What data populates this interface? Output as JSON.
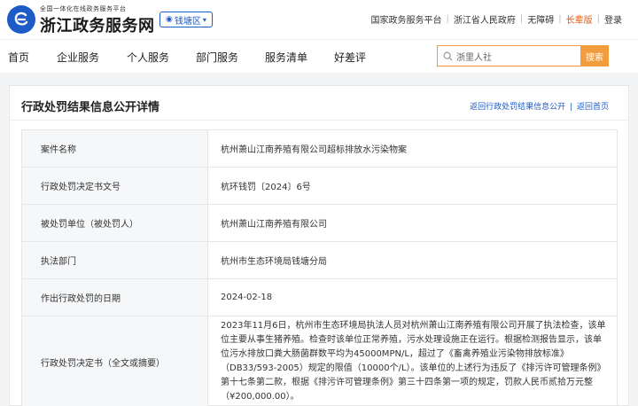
{
  "header": {
    "subtitle": "全国一体化在线政务服务平台",
    "title": "浙江政务服务网",
    "region": "钱塘区",
    "links": [
      "国家政务服务平台",
      "浙江省人民政府",
      "无障碍",
      "长辈版",
      "登录"
    ]
  },
  "nav": {
    "items": [
      "首页",
      "企业服务",
      "个人服务",
      "部门服务",
      "服务清单",
      "好差评"
    ]
  },
  "search": {
    "value": "浙里人社",
    "button": "搜索"
  },
  "page": {
    "title": "行政处罚结果信息公开详情",
    "back_list": "返回行政处罚结果信息公开",
    "link_sep": "|",
    "back_home": "返回首页"
  },
  "details": [
    {
      "label": "案件名称",
      "value": "杭州萧山江南养殖有限公司超标排放水污染物案"
    },
    {
      "label": "行政处罚决定书文号",
      "value": "杭环钱罚〔2024〕6号"
    },
    {
      "label": "被处罚单位（被处罚人）",
      "value": "杭州萧山江南养殖有限公司"
    },
    {
      "label": "执法部门",
      "value": "杭州市生态环境局钱塘分局"
    },
    {
      "label": "作出行政处罚的日期",
      "value": "2024-02-18"
    },
    {
      "label": "行政处罚决定书（全文或摘要）",
      "value": "2023年11月6日，杭州市生态环境局执法人员对杭州萧山江南养殖有限公司开展了执法检查，该单位主要从事生猪养殖。检查时该单位正常养殖，污水处理设施正在运行。根据检测报告显示，该单位污水排放口粪大肠菌群数平均为45000MPN/L，超过了《畜禽养殖业污染物排放标准》（DB33/593-2005）规定的限值（10000个/L）。该单位的上述行为违反了《排污许可管理条例》第十七条第二款，根据《排污许可管理条例》第三十四条第一项的规定，罚款人民币贰拾万元整（¥200,000.00）。"
    }
  ],
  "colors": {
    "brand_blue": "#1d5bc7",
    "accent_orange": "#f39c3d",
    "elder_orange": "#e8590c"
  }
}
